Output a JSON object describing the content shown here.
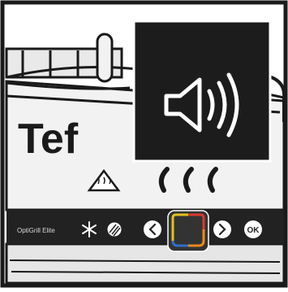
{
  "brand": {
    "logo_text": "Tef"
  },
  "control_panel": {
    "model_name": "OptiGrill Elite",
    "buttons": [
      {
        "id": "defrost",
        "icon": "snowflake-icon"
      },
      {
        "id": "manual",
        "icon": "grill-pattern-icon"
      },
      {
        "id": "prev",
        "icon": "chevron-left-icon"
      },
      {
        "id": "next",
        "icon": "chevron-right-icon"
      },
      {
        "id": "ok",
        "label": "OK"
      }
    ],
    "display_ring_colors": [
      "#e0c21f",
      "#d83a2c",
      "#2e6fc9",
      "#e98a1b"
    ]
  },
  "popup": {
    "icon": "speaker-volume-icon"
  },
  "colors": {
    "frame": "#1a1a1a",
    "panel": "#222222",
    "body_fill": "#f2f2f2"
  }
}
